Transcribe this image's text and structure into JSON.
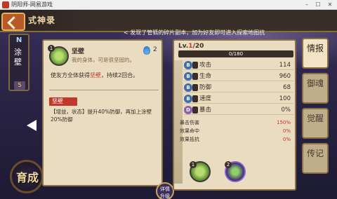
{
  "window": {
    "title": "阴阳师-网易游戏",
    "controls": {
      "minimize": "–",
      "maximize": "☐",
      "close": "✕"
    }
  },
  "banner": {
    "title": "式神录",
    "marquee": "< 发现了管狐的碎片副本，加为好友即可进入探索地图抗"
  },
  "shikigami": {
    "rarity": "N",
    "name": "涂壁",
    "stars": "5"
  },
  "skill": {
    "number": "1",
    "name": "坚壁",
    "quote": "我的身体，可是很坚固的。",
    "cost": "2",
    "desc_prefix": "使友方全体获得",
    "desc_highlight": "坚壁",
    "desc_suffix": "，持续2回合。",
    "effect_tag": "坚壁",
    "detail_prefix": "【增益，状态】提升40%防御，再加上涂壁20%防御",
    "detail_suffix": ""
  },
  "stats": {
    "lv_prefix": "Lv.",
    "lv_current": "1",
    "lv_max": "/20",
    "exp_text": "0/180",
    "exp_fraction": 0,
    "rows": [
      {
        "grade": "B",
        "label": "攻击",
        "value": "114"
      },
      {
        "grade": "B",
        "label": "生命",
        "value": "960"
      },
      {
        "grade": "B",
        "label": "防御",
        "value": "68"
      },
      {
        "grade": "B",
        "label": "速度",
        "value": "100"
      },
      {
        "grade": "D",
        "label": "暴击",
        "value": "0%"
      }
    ],
    "sub_rows": [
      {
        "label": "暴击伤害",
        "value": "150%"
      },
      {
        "label": "效果命中",
        "value": "0%"
      },
      {
        "label": "效果抵抗",
        "value": "0%"
      }
    ],
    "skill_slots": [
      "1",
      "2"
    ]
  },
  "tabs": [
    {
      "label": "情报"
    },
    {
      "label": "御魂"
    },
    {
      "label": "觉醒"
    },
    {
      "label": "传记"
    }
  ],
  "buttons": {
    "detail": "详情",
    "upgrade": "升级"
  },
  "logo": {
    "text": "育成"
  }
}
